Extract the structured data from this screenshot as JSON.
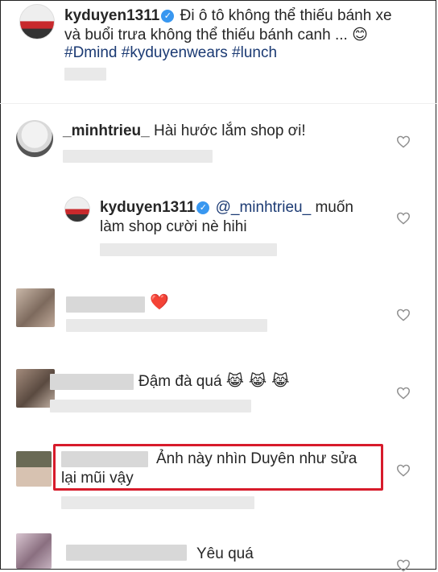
{
  "caption": {
    "username": "kyduyen1311",
    "line1": "Đi ô tô không thể thiếu bánh xe",
    "line2": "và buổi trưa không thể thiếu bánh canh ...",
    "emoji": "😊",
    "hashtags": "#Dmind #kyduyenwears #lunch"
  },
  "comments": [
    {
      "username": "_minhtrieu_",
      "text": "Hài hước lắm shop ơi!"
    },
    {
      "username": "kyduyen1311",
      "mention": "@_minhtrieu_",
      "text_line1": "muốn",
      "text_line2": "làm shop cười nè hihi"
    },
    {
      "username": "",
      "text": "❤️"
    },
    {
      "username": "",
      "text": "Đậm đà quá",
      "emoji": "😹 😹 😹"
    },
    {
      "username": "",
      "text_line1": "Ảnh này nhìn Duyên như sửa",
      "text_line2": "lại mũi vậy"
    },
    {
      "username": "",
      "text": "Yêu quá"
    }
  ],
  "colors": {
    "accent": "#3897f0",
    "highlight": "#d71b2b",
    "hashtag": "#1b3a73"
  }
}
